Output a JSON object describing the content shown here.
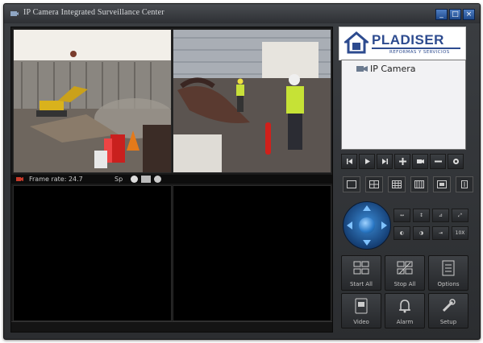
{
  "window": {
    "title": "IP Camera Integrated Surveillance Center",
    "controls": [
      "_",
      "□",
      "×"
    ]
  },
  "video": {
    "status_frame_rate": "Frame rate: 24.7",
    "status_sp": "Sp",
    "icons": [
      "record-icon",
      "snapshot-icon",
      "settings-icon"
    ]
  },
  "logo": {
    "name": "PLADISER",
    "subtitle": "REFORMAS Y SERVICIOS"
  },
  "tree": {
    "items": [
      {
        "label": "IP Camera",
        "icon": "camera-folder-icon"
      }
    ]
  },
  "playback_controls": [
    {
      "name": "prev-button",
      "icon": "skip-back-icon"
    },
    {
      "name": "play-button",
      "icon": "play-icon"
    },
    {
      "name": "next-button",
      "icon": "skip-forward-icon"
    },
    {
      "name": "add-button",
      "icon": "plus-icon"
    },
    {
      "name": "camera-add-button",
      "icon": "camera-icon"
    },
    {
      "name": "remove-button",
      "icon": "minus-icon"
    },
    {
      "name": "config-button",
      "icon": "gear-icon"
    }
  ],
  "layout_controls": [
    {
      "name": "layout-1-button",
      "icon": "single-view-icon"
    },
    {
      "name": "layout-4-button",
      "icon": "quad-view-icon"
    },
    {
      "name": "layout-9-button",
      "icon": "nine-view-icon"
    },
    {
      "name": "layout-16-button",
      "icon": "sixteen-view-icon"
    },
    {
      "name": "layout-full-button",
      "icon": "fullscreen-icon"
    },
    {
      "name": "layout-exit-button",
      "icon": "exit-icon"
    }
  ],
  "ptz_buttons": [
    {
      "name": "zoom-in-button",
      "label": "↔"
    },
    {
      "name": "zoom-out-button",
      "label": "↕"
    },
    {
      "name": "focus-near-button",
      "label": "⊿"
    },
    {
      "name": "focus-far-button",
      "label": "⤢"
    },
    {
      "name": "iris-open-button",
      "label": "◐"
    },
    {
      "name": "iris-close-button",
      "label": "◑"
    },
    {
      "name": "speed-button",
      "label": "⇥"
    },
    {
      "name": "step-button",
      "label": "10X"
    }
  ],
  "actions": [
    {
      "name": "start-all-button",
      "label": "Start All",
      "icon": "start-all-icon"
    },
    {
      "name": "stop-all-button",
      "label": "Stop All",
      "icon": "stop-all-icon"
    },
    {
      "name": "options-button",
      "label": "Options",
      "icon": "options-icon"
    },
    {
      "name": "video-button",
      "label": "Video",
      "icon": "video-icon"
    },
    {
      "name": "alarm-button",
      "label": "Alarm",
      "icon": "alarm-bell-icon"
    },
    {
      "name": "setup-button",
      "label": "Setup",
      "icon": "wrench-icon"
    }
  ]
}
